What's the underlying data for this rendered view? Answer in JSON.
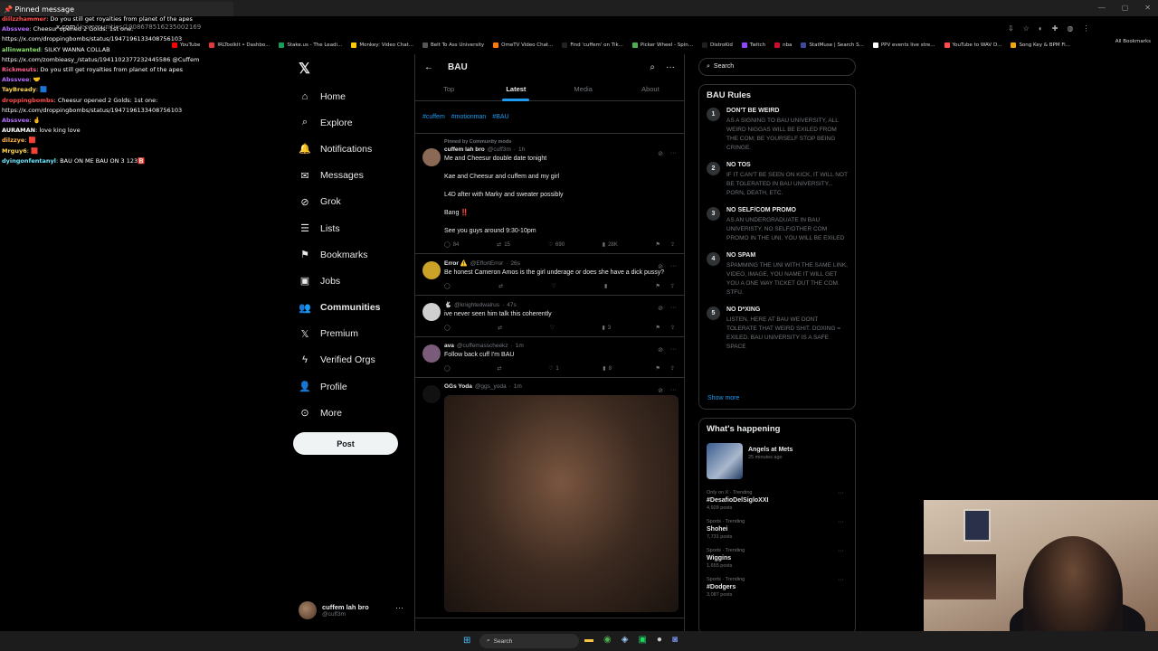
{
  "browser": {
    "url_host": "x.com",
    "url_path": "/i/communities/1908678516235002169",
    "all_bookmarks": "All Bookmarks",
    "bookmarks": [
      {
        "label": "YouTube",
        "color": "#ff0000"
      },
      {
        "label": "IRLToolkit • Dashbo...",
        "color": "#e0393e"
      },
      {
        "label": "Stake.us - The Leadi...",
        "color": "#1a9c5b"
      },
      {
        "label": "Monkey: Video Chat...",
        "color": "#ffcc00"
      },
      {
        "label": "Belt To Ass University",
        "color": "#555555"
      },
      {
        "label": "OmeTV Video Chat...",
        "color": "#ff7a00"
      },
      {
        "label": "Find 'cuffem' on Tik...",
        "color": "#222222"
      },
      {
        "label": "Picker Wheel - Spin...",
        "color": "#4caf50"
      },
      {
        "label": "DistroKid",
        "color": "#1f1f1f"
      },
      {
        "label": "Twitch",
        "color": "#9146ff"
      },
      {
        "label": "nba",
        "color": "#c8102e"
      },
      {
        "label": "StatMuse | Search S...",
        "color": "#3d4a9c"
      },
      {
        "label": "PPV events live stre...",
        "color": "#ffffff"
      },
      {
        "label": "YouTube to WAV D...",
        "color": "#ff4d4d"
      },
      {
        "label": "Song Key & BPM Fi...",
        "color": "#f7a600"
      }
    ]
  },
  "chat": {
    "pinned_label": "Pinned message",
    "lines": [
      {
        "user": "dillzzhammer",
        "color": "#ff4f4f",
        "text": "Do you still get royalties from planet of the apes"
      },
      {
        "user": "Abssvee",
        "color": "#b76bff",
        "text": "Cheesur opened 2 Golds: 1st one:"
      },
      {
        "user": "",
        "color": "#ffffff",
        "text": "https://x.com/droppingbombs/status/1947196133408756103"
      },
      {
        "user": "allinwanted",
        "color": "#8be36f",
        "text": "SILKY WANNA COLLAB"
      },
      {
        "user": "",
        "color": "#ffffff",
        "text": "https://x.com/zombieasy_/status/1941102377232445586 @Cuffem"
      },
      {
        "user": "Rickmeuts",
        "color": "#ff5e8e",
        "text": "Do you still get royalties from planet of the apes"
      },
      {
        "user": "Abssvee",
        "color": "#b76bff",
        "text": "🤝"
      },
      {
        "user": "TayBready",
        "color": "#ffd84d",
        "text": "🟦"
      },
      {
        "user": "droppingbombs",
        "color": "#ff4d4d",
        "text": "Cheesur opened 2 Golds: 1st one:"
      },
      {
        "user": "",
        "color": "#ffffff",
        "text": "https://x.com/droppingbombs/status/1947196133408756103"
      },
      {
        "user": "Abssvee",
        "color": "#b76bff",
        "text": "🤞"
      },
      {
        "user": "AURAMAN",
        "color": "#ffffff",
        "text": "love king love"
      },
      {
        "user": "dilzzye",
        "color": "#ffb347",
        "text": "🟥"
      },
      {
        "user": "Mrguy6",
        "color": "#ffd84d",
        "text": "🟥"
      },
      {
        "user": "dyingonfentanyl",
        "color": "#6ee7ff",
        "text": "BAU ON ME BAU ON 3 123🅱️"
      }
    ]
  },
  "nav": {
    "items": [
      {
        "label": "Home",
        "icon": "home-icon",
        "glyph": "⌂",
        "dot": false,
        "active": false
      },
      {
        "label": "Explore",
        "icon": "search-icon",
        "glyph": "⌕",
        "dot": false,
        "active": false
      },
      {
        "label": "Notifications",
        "icon": "bell-icon",
        "glyph": "🔔",
        "dot": true,
        "active": false
      },
      {
        "label": "Messages",
        "icon": "mail-icon",
        "glyph": "✉",
        "dot": true,
        "active": false
      },
      {
        "label": "Grok",
        "icon": "grok-icon",
        "glyph": "⊘",
        "dot": false,
        "active": false
      },
      {
        "label": "Lists",
        "icon": "list-icon",
        "glyph": "☰",
        "dot": false,
        "active": false
      },
      {
        "label": "Bookmarks",
        "icon": "bookmark-icon",
        "glyph": "⚑",
        "dot": false,
        "active": false
      },
      {
        "label": "Jobs",
        "icon": "briefcase-icon",
        "glyph": "▣",
        "dot": false,
        "active": false
      },
      {
        "label": "Communities",
        "icon": "people-icon",
        "glyph": "👥",
        "dot": false,
        "active": true
      },
      {
        "label": "Premium",
        "icon": "x-icon",
        "glyph": "𝕏",
        "dot": false,
        "active": false
      },
      {
        "label": "Verified Orgs",
        "icon": "lightning-icon",
        "glyph": "ϟ",
        "dot": false,
        "active": false
      },
      {
        "label": "Profile",
        "icon": "person-icon",
        "glyph": "👤",
        "dot": false,
        "active": false
      },
      {
        "label": "More",
        "icon": "more-circle-icon",
        "glyph": "⊙",
        "dot": false,
        "active": false
      }
    ],
    "post_label": "Post"
  },
  "account": {
    "name": "cuffem lah bro",
    "handle": "@cuff3m"
  },
  "community": {
    "title": "BAU",
    "tabs": [
      "Top",
      "Latest",
      "Media",
      "About"
    ],
    "active_tab": 1,
    "hashtags": [
      "#cuffem",
      "#motionman",
      "#BAU"
    ]
  },
  "tweets": [
    {
      "pinned": "Pinned by Community mods",
      "name": "cuffem lah bro",
      "handle": "@cuff3m",
      "time": "1h",
      "avatar": "#8a6a55",
      "lines": [
        "Me and Cheesur double date tonight",
        "Kae and Cheesur and cuffem and my girl",
        "L4D after with Marky and sweater possibly",
        "Bang ‼️",
        "See you guys around 9:30-10pm"
      ],
      "replies": "84",
      "reposts": "15",
      "likes": "690",
      "views": "28K"
    },
    {
      "pinned": "",
      "name": "Error ⚠️",
      "handle": "@EffortError",
      "time": "26s",
      "avatar": "#c9a227",
      "lines": [
        "Be honest Cameron Amos is the girl underage or does she have a dick pussy?"
      ],
      "replies": "",
      "reposts": "",
      "likes": "",
      "views": ""
    },
    {
      "pinned": "",
      "name": "🐇",
      "handle": "@knightedwalrus",
      "time": "47s",
      "avatar": "#cfcfcf",
      "lines": [
        "ive never seen him talk this coherently"
      ],
      "replies": "",
      "reposts": "",
      "likes": "",
      "views": "3"
    },
    {
      "pinned": "",
      "name": "ava",
      "handle": "@cuffemasscheekz",
      "time": "1m",
      "avatar": "#7a5b7a",
      "lines": [
        "Follow back cuff I'm BAU"
      ],
      "replies": "",
      "reposts": "",
      "likes": "1",
      "views": "8"
    },
    {
      "pinned": "",
      "name": "GGs Yoda",
      "handle": "@ggs_yoda",
      "time": "1m",
      "avatar": "#111111",
      "lines": [],
      "replies": "",
      "reposts": "",
      "likes": "",
      "views": ""
    }
  ],
  "search": {
    "placeholder": "Search"
  },
  "rules": {
    "title": "BAU Rules",
    "items": [
      {
        "num": "1",
        "title": "DON'T BE WEIRD",
        "desc": "AS A SIGNING TO BAU UNIVERSITY, ALL WEIRD NIGGAS WILL BE EXILED FROM THE COM; BE YOURSELF STOP BEING CRINGE."
      },
      {
        "num": "2",
        "title": "NO TOS",
        "desc": "IF IT CAN'T BE SEEN ON KICK, IT WILL NOT BE TOLERATED IN BAU UNIVERSITY... PORN, DEATH, ETC."
      },
      {
        "num": "3",
        "title": "NO SELF/COM PROMO",
        "desc": "AS AN UNDERGRADUATE IN BAU UNIVERISTY, NO SELF/OTHER COM PROMO IN THE UNI. YOU WILL BE EXILED"
      },
      {
        "num": "4",
        "title": "NO SPAM",
        "desc": "SPAMMING THE UNI WITH THE SAME LINK, VIDEO, IMAGE, YOU NAME IT WILL GET YOU A ONE WAY TICKET OUT THE COM. STFU."
      },
      {
        "num": "5",
        "title": "NO D*XING",
        "desc": "LISTEN. HERE AT BAU WE DONT TOLERATE THAT WEIRD SHIT. DOXING = EXILED. BAU UNIVERSITY IS A SAFE SPACE"
      }
    ],
    "show_more": "Show more"
  },
  "trends": {
    "title": "What's happening",
    "event": {
      "title": "Angels at Mets",
      "sub": "25 minutes ago"
    },
    "items": [
      {
        "context": "Only on X · Trending",
        "name": "#DesafioDelSigloXXI",
        "posts": "4,928 posts"
      },
      {
        "context": "Sports · Trending",
        "name": "Shohei",
        "posts": "7,731 posts"
      },
      {
        "context": "Sports · Trending",
        "name": "Wiggins",
        "posts": "1,655 posts"
      },
      {
        "context": "Sports · Trending",
        "name": "#Dodgers",
        "posts": "3,087 posts"
      }
    ]
  },
  "taskbar": {
    "search": "Search"
  }
}
